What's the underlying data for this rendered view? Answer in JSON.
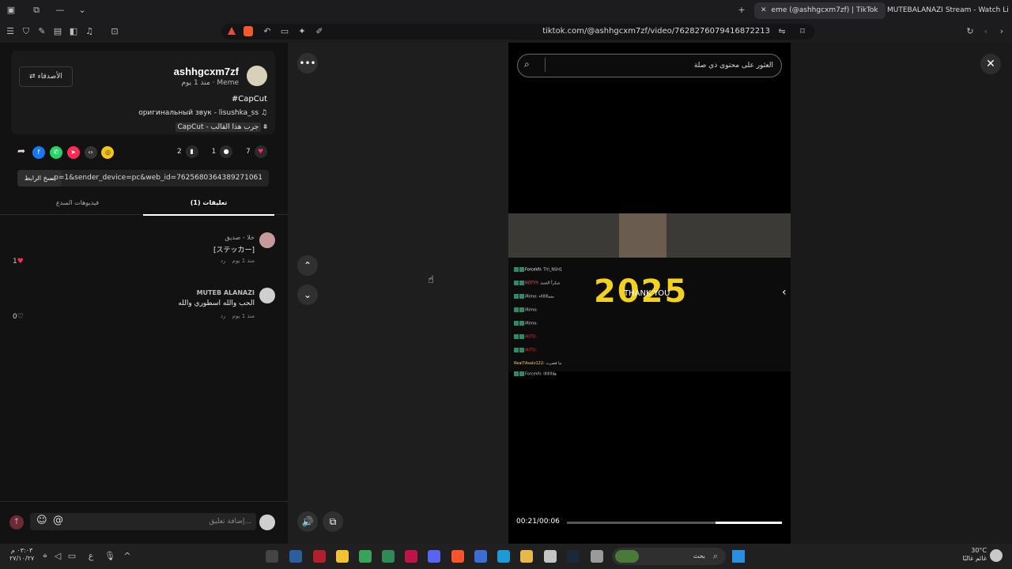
{
  "browser": {
    "tabs": [
      {
        "label": "eme (@ashhgcxm7zf) | TikTok",
        "active": true
      },
      {
        "label": "MUTEBALANAZI Stream - Watch Live",
        "active": false
      }
    ],
    "url": "tiktok.com/@ashhgcxm7zf/video/7628276079416872213"
  },
  "post": {
    "username": "ashhgcxm7zf",
    "meta": "Meme · منذ 1 يوم",
    "follow_label": "الأصدقاء",
    "hashtag": "#CapCut",
    "sound": "оригинальный звук - lisushka_ss",
    "capcut": "CapCut - جرب هذا القالب",
    "likes": "7",
    "comments": "1",
    "saves": "2",
    "link": "...p=1&sender_device=pc&web_id=7625680364389271061",
    "copy_label": "نسخ الرابط"
  },
  "tabs": {
    "comments": "(1) تعليقات",
    "creator_videos": "فيديوهات المبدع"
  },
  "comments": [
    {
      "name": "خلا - صديق",
      "text": "[ステッカー]",
      "time": "منذ 1 يوم",
      "reply": "رد",
      "likes": "1"
    },
    {
      "name": "MUTEB ALANAZI",
      "text": "الحب والله اسطوري والله",
      "time": "منذ 1 يوم",
      "reply": "رد",
      "likes": "0"
    }
  ],
  "comment_input": {
    "placeholder": "إضافة تعليق..."
  },
  "video": {
    "search_placeholder": "العثور على محتوى ذي صلة",
    "year_text": "2025",
    "thank_you": "THANK YOU",
    "timecode": "00:21/00:06",
    "progress": 0.31,
    "chat": [
      {
        "user": "ForceVII:",
        "msg": "Titi_NSH1"
      },
      {
        "user": "ROTYY:",
        "msg": "شكراً العسد"
      },
      {
        "user": "iRimo:",
        "msg": "مساااااااء"
      },
      {
        "user": "iRimo:",
        "msg": ""
      },
      {
        "user": "iRimo:",
        "msg": ""
      },
      {
        "user": "iRITO:",
        "msg": ""
      },
      {
        "user": "iRITO:",
        "msg": ""
      },
      {
        "user": "Real7Asalo122:",
        "msg": "ما قصرت"
      },
      {
        "user": "ForceVII:",
        "msg": "هلااااااااا"
      }
    ]
  },
  "taskbar": {
    "search_label": "بحث",
    "weather_temp": "30°C",
    "weather_desc": "غائم غالبًا",
    "clock_time": "٠٣:٠٣ م",
    "clock_date": "٢٧/١٠/٢٧"
  }
}
